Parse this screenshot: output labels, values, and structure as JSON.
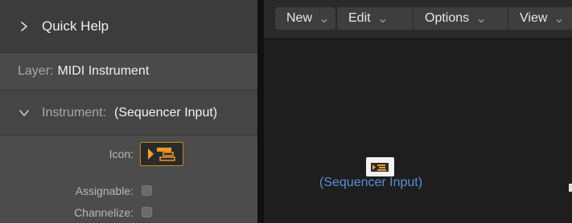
{
  "inspector": {
    "quick_help": "Quick Help",
    "layer_key": "Layer:",
    "layer_value": "MIDI Instrument",
    "instrument_key": "Instrument:",
    "instrument_value": "(Sequencer Input)",
    "params": {
      "icon_label": "Icon:",
      "assignable_label": "Assignable:",
      "channelize_label": "Channelize:",
      "assignable_checked": false,
      "channelize_checked": false
    }
  },
  "environment": {
    "menus": [
      "New",
      "Edit",
      "Options",
      "View"
    ],
    "object_label": "(Sequencer Input)"
  },
  "icons": {
    "quick_help_chevron": "chevron-right-icon",
    "instrument_chevron": "chevron-down-icon",
    "menu_arrow": "chevron-down-icon",
    "instrument_icon": "sequencer-input-icon"
  },
  "colors": {
    "accent_orange": "#c88428",
    "label_blue": "#5a8fd8"
  }
}
